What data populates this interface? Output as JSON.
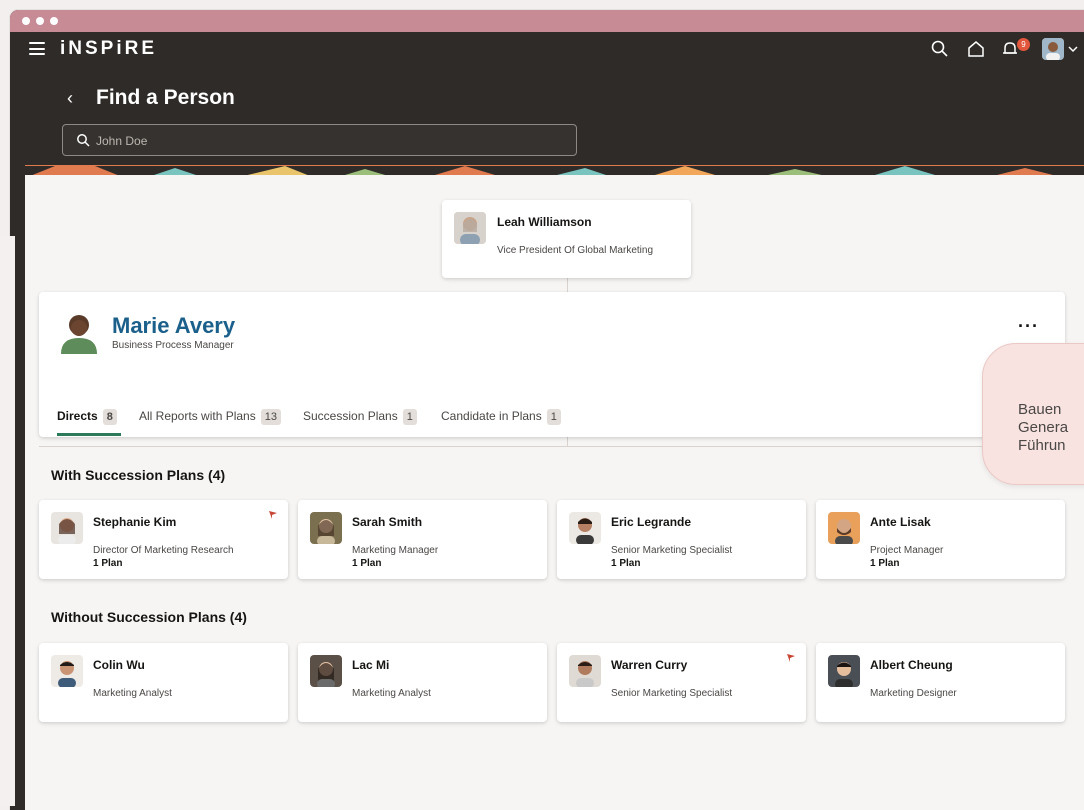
{
  "app": {
    "brand": "iNSPiRE",
    "notification_count": "9"
  },
  "page": {
    "title": "Find a Person",
    "search_placeholder": "John Doe"
  },
  "manager": {
    "name": "Leah Williamson",
    "title": "Vice President Of Global Marketing"
  },
  "focus": {
    "name": "Marie Avery",
    "title": "Business Process Manager",
    "more_label": "···"
  },
  "tabs": [
    {
      "label": "Directs",
      "count": "8"
    },
    {
      "label": "All Reports with Plans",
      "count": "13"
    },
    {
      "label": "Succession Plans",
      "count": "1"
    },
    {
      "label": "Candidate in Plans",
      "count": "1"
    }
  ],
  "sections": {
    "with_plans": "With Succession Plans (4)",
    "without_plans": "Without Succession Plans (4)"
  },
  "with_plans": [
    {
      "name": "Stephanie Kim",
      "title": "Director Of Marketing Research",
      "plan": "1 Plan",
      "flag": true
    },
    {
      "name": "Sarah Smith",
      "title": "Marketing Manager",
      "plan": "1 Plan",
      "flag": false
    },
    {
      "name": "Eric Legrande",
      "title": "Senior Marketing Specialist",
      "plan": "1 Plan",
      "flag": false
    },
    {
      "name": "Ante Lisak",
      "title": "Project Manager",
      "plan": "1 Plan",
      "flag": false
    }
  ],
  "without_plans": [
    {
      "name": "Colin Wu",
      "title": "Marketing Analyst",
      "flag": false
    },
    {
      "name": "Lac Mi",
      "title": "Marketing Analyst",
      "flag": false
    },
    {
      "name": "Warren Curry",
      "title": "Senior Marketing Specialist",
      "flag": true
    },
    {
      "name": "Albert Cheung",
      "title": "Marketing Designer",
      "flag": false
    }
  ],
  "tooltip": {
    "lines": [
      "Bauen",
      "Genera",
      "Führun"
    ]
  },
  "colors": {
    "header_bg": "#2f2b28",
    "titlebar": "#c78b96",
    "accent_name": "#1b5f8b",
    "tab_active": "#2c7a5a",
    "flag": "#c74634",
    "tooltip_bg": "#f8e3e1"
  }
}
